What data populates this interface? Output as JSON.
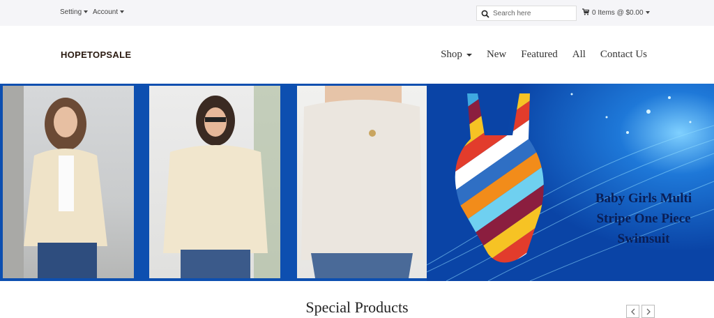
{
  "topbar": {
    "setting_label": "Setting",
    "account_label": "Account",
    "search_placeholder": "Search here",
    "cart_label": "0 Items @ $0.00"
  },
  "header": {
    "logo": "HOPETOPSALE",
    "nav": [
      {
        "label": "Shop",
        "has_dropdown": true
      },
      {
        "label": "New"
      },
      {
        "label": "Featured"
      },
      {
        "label": "All"
      },
      {
        "label": "Contact Us"
      }
    ]
  },
  "banner": {
    "caption_lines": [
      "Baby Girls Multi",
      "Stripe One Piece",
      "Swimsuit"
    ],
    "background_color": "#0d4fb0"
  },
  "section": {
    "title": "Special Products"
  },
  "icons": {
    "search": "search-icon",
    "cart": "cart-icon",
    "prev": "chevron-left-icon",
    "next": "chevron-right-icon"
  }
}
